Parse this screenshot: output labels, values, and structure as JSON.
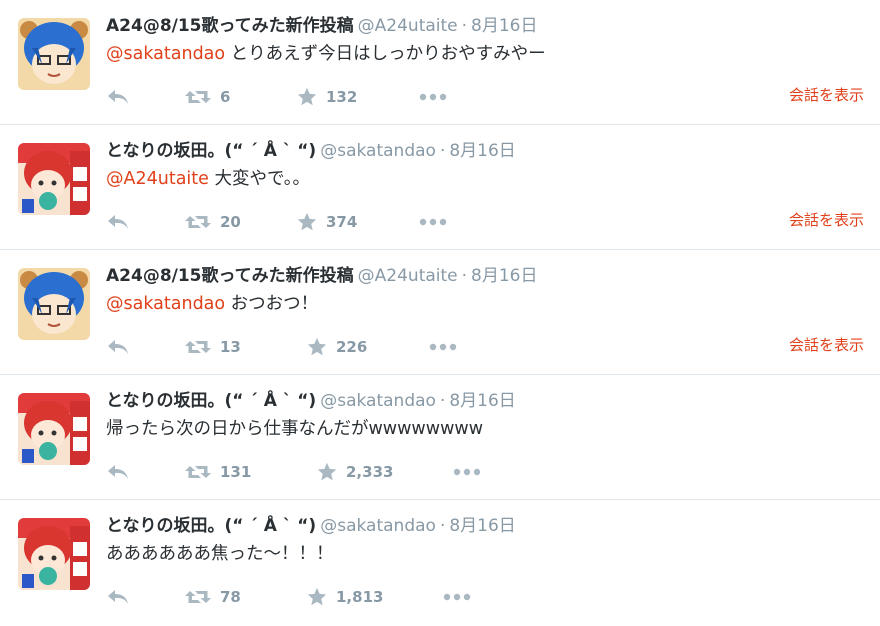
{
  "tweets": [
    {
      "fullname": "A24@8/15歌ってみた新作投稿",
      "username": "@A24utaite",
      "sep": "·",
      "time": "8月16日",
      "mention": "@sakatandao",
      "text": " とりあえず今日はしっかりおやすみやー",
      "retweets": "6",
      "favorites": "132",
      "conversation": "会話を表示",
      "avatar": "blue-hair-anime-avatar"
    },
    {
      "fullname": "となりの坂田。(“ ´ Å ` “)",
      "username": "@sakatandao",
      "sep": "·",
      "time": "8月16日",
      "mention": "@A24utaite",
      "text": " 大変やで。。",
      "retweets": "20",
      "favorites": "374",
      "conversation": "会話を表示",
      "avatar": "red-hair-anime-avatar"
    },
    {
      "fullname": "A24@8/15歌ってみた新作投稿",
      "username": "@A24utaite",
      "sep": "·",
      "time": "8月16日",
      "mention": "@sakatandao",
      "text": " おつおつ！",
      "retweets": "13",
      "favorites": "226",
      "conversation": "会話を表示",
      "avatar": "blue-hair-anime-avatar"
    },
    {
      "fullname": "となりの坂田。(“ ´ Å ` “)",
      "username": "@sakatandao",
      "sep": "·",
      "time": "8月16日",
      "mention": "",
      "text": "帰ったら次の日から仕事なんだがwwwwwwww",
      "retweets": "131",
      "favorites": "2,333",
      "conversation": "",
      "avatar": "red-hair-anime-avatar"
    },
    {
      "fullname": "となりの坂田。(“ ´ Å ` “)",
      "username": "@sakatandao",
      "sep": "·",
      "time": "8月16日",
      "mention": "",
      "text": "ああああああ焦った〜！！！",
      "retweets": "78",
      "favorites": "1,813",
      "conversation": "",
      "avatar": "red-hair-anime-avatar"
    }
  ],
  "colors": {
    "mention": "#e0411a",
    "meta": "#8899a6",
    "text": "#292f33",
    "icon": "#aab8c2",
    "divider": "#e1e8ed"
  }
}
